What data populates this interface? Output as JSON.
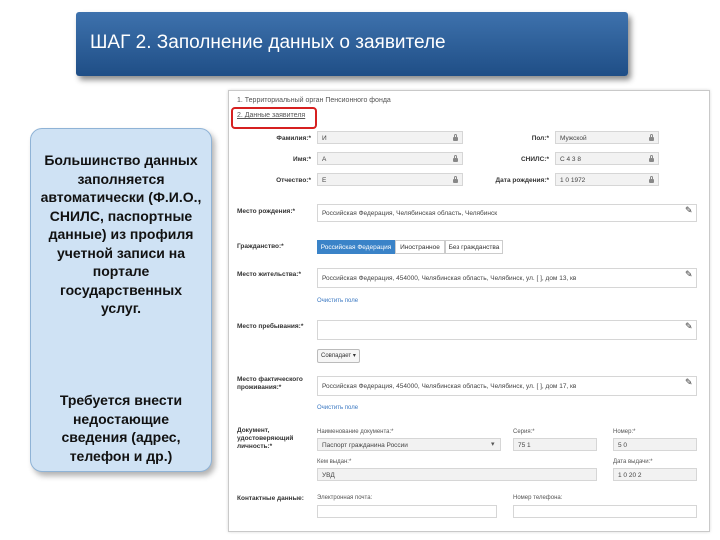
{
  "slide": {
    "title": "ШАГ 2. Заполнение данных о заявителе",
    "callout_p1": "Большинство данных заполняется автоматически (Ф.И.О., СНИЛС, паспортные данные) из профиля учетной записи на портале государственных услуг.",
    "callout_p2": "Требуется внести недостающие сведения (адрес, телефон и др.)"
  },
  "form": {
    "step1": "1. Территориальный орган Пенсионного фонда",
    "step2": "2. Данные заявителя",
    "surname_label": "Фамилия:*",
    "surname_value": "И",
    "sex_label": "Пол:*",
    "sex_value": "Мужской",
    "name_label": "Имя:*",
    "name_value": "А",
    "snils_label": "СНИЛС:*",
    "snils_value": "С   4   3   8",
    "patronymic_label": "Отчество:*",
    "patronymic_value": "Е",
    "birthdate_label": "Дата рождения:*",
    "birthdate_value": "1   0   1972",
    "birthplace_label": "Место рождения:*",
    "birthplace_value": "Российская Федерация, Челябинская область, Челябинск",
    "citizenship_label": "Гражданство:*",
    "citizenship_options": [
      "Российская Федерация",
      "Иностранное",
      "Без гражданства"
    ],
    "residence_label": "Место жительства:*",
    "residence_value": "Российская Федерация, 454000, Челябинская область, Челябинск, ул. [                  ], дом 13, кв",
    "residence_link": "Очистить поле",
    "stay_label": "Место пребывания:*",
    "stay_button": "Совпадает",
    "actual_label": "Место фактического проживания:*",
    "actual_value": "Российская Федерация, 454000, Челябинская область, Челябинск, ул. [                  ], дом 17, кв",
    "actual_link": "Очистить поле",
    "doc_label": "Документ, удостоверяющий личность:*",
    "doc_type_sublabel": "Наименование документа:*",
    "doc_type_value": "Паспорт гражданина России",
    "series_sublabel": "Серия:*",
    "series_value": "75   1",
    "number_sublabel": "Номер:*",
    "number_value": "5   0",
    "issuer_sublabel": "Кем выдан:*",
    "issuer_value": "УВД",
    "issue_date_sublabel": "Дата выдачи:*",
    "issue_date_value": "1   0   20   2",
    "contacts_label": "Контактные данные:",
    "email_sublabel": "Электронная почта:",
    "phone_sublabel": "Номер телефона:"
  }
}
